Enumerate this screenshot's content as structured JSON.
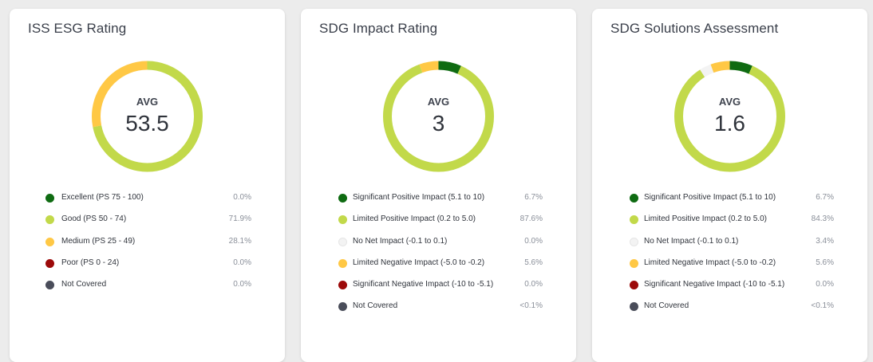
{
  "cards": [
    {
      "title": "ISS ESG Rating",
      "avg_label": "AVG",
      "avg_value": "53.5",
      "legend": [
        {
          "label": "Excellent (PS 75 - 100)",
          "pct": "0.0%",
          "color": "#0f6b12"
        },
        {
          "label": "Good (PS 50 - 74)",
          "pct": "71.9%",
          "color": "#c2d94a"
        },
        {
          "label": "Medium (PS 25 - 49)",
          "pct": "28.1%",
          "color": "#ffc845"
        },
        {
          "label": "Poor (PS 0 - 24)",
          "pct": "0.0%",
          "color": "#9c0a0a"
        },
        {
          "label": "Not Covered",
          "pct": "0.0%",
          "color": "#4a4d5a"
        }
      ]
    },
    {
      "title": "SDG Impact Rating",
      "avg_label": "AVG",
      "avg_value": "3",
      "legend": [
        {
          "label": "Significant Positive Impact (5.1 to 10)",
          "pct": "6.7%",
          "color": "#0f6b12"
        },
        {
          "label": "Limited Positive Impact (0.2 to 5.0)",
          "pct": "87.6%",
          "color": "#c2d94a"
        },
        {
          "label": "No Net Impact (-0.1 to 0.1)",
          "pct": "0.0%",
          "color": "#f3f3f3"
        },
        {
          "label": "Limited Negative Impact (-5.0 to -0.2)",
          "pct": "5.6%",
          "color": "#ffc845"
        },
        {
          "label": "Significant Negative Impact (-10 to -5.1)",
          "pct": "0.0%",
          "color": "#9c0a0a"
        },
        {
          "label": "Not Covered",
          "pct": "<0.1%",
          "color": "#4a4d5a"
        }
      ]
    },
    {
      "title": "SDG Solutions Assessment",
      "avg_label": "AVG",
      "avg_value": "1.6",
      "legend": [
        {
          "label": "Significant Positive Impact (5.1 to 10)",
          "pct": "6.7%",
          "color": "#0f6b12"
        },
        {
          "label": "Limited Positive Impact (0.2 to 5.0)",
          "pct": "84.3%",
          "color": "#c2d94a"
        },
        {
          "label": "No Net Impact (-0.1 to 0.1)",
          "pct": "3.4%",
          "color": "#f3f3f3"
        },
        {
          "label": "Limited Negative Impact (-5.0 to -0.2)",
          "pct": "5.6%",
          "color": "#ffc845"
        },
        {
          "label": "Significant Negative Impact (-10 to -5.1)",
          "pct": "0.0%",
          "color": "#9c0a0a"
        },
        {
          "label": "Not Covered",
          "pct": "<0.1%",
          "color": "#4a4d5a"
        }
      ]
    }
  ],
  "chart_data": [
    {
      "type": "pie",
      "title": "ISS ESG Rating",
      "categories": [
        "Excellent (PS 75 - 100)",
        "Good (PS 50 - 74)",
        "Medium (PS 25 - 49)",
        "Poor (PS 0 - 24)",
        "Not Covered"
      ],
      "values": [
        0.0,
        71.9,
        28.1,
        0.0,
        0.0
      ],
      "colors": [
        "#0f6b12",
        "#c2d94a",
        "#ffc845",
        "#9c0a0a",
        "#4a4d5a"
      ]
    },
    {
      "type": "pie",
      "title": "SDG Impact Rating",
      "categories": [
        "Significant Positive Impact (5.1 to 10)",
        "Limited Positive Impact (0.2 to 5.0)",
        "No Net Impact (-0.1 to 0.1)",
        "Limited Negative Impact (-5.0 to -0.2)",
        "Significant Negative Impact (-10 to -5.1)",
        "Not Covered"
      ],
      "values": [
        6.7,
        87.6,
        0.0,
        5.6,
        0.0,
        0.05
      ],
      "colors": [
        "#0f6b12",
        "#c2d94a",
        "#f3f3f3",
        "#ffc845",
        "#9c0a0a",
        "#4a4d5a"
      ]
    },
    {
      "type": "pie",
      "title": "SDG Solutions Assessment",
      "categories": [
        "Significant Positive Impact (5.1 to 10)",
        "Limited Positive Impact (0.2 to 5.0)",
        "No Net Impact (-0.1 to 0.1)",
        "Limited Negative Impact (-5.0 to -0.2)",
        "Significant Negative Impact (-10 to -5.1)",
        "Not Covered"
      ],
      "values": [
        6.7,
        84.3,
        3.4,
        5.6,
        0.0,
        0.05
      ],
      "colors": [
        "#0f6b12",
        "#c2d94a",
        "#f3f3f3",
        "#ffc845",
        "#9c0a0a",
        "#4a4d5a"
      ]
    }
  ]
}
